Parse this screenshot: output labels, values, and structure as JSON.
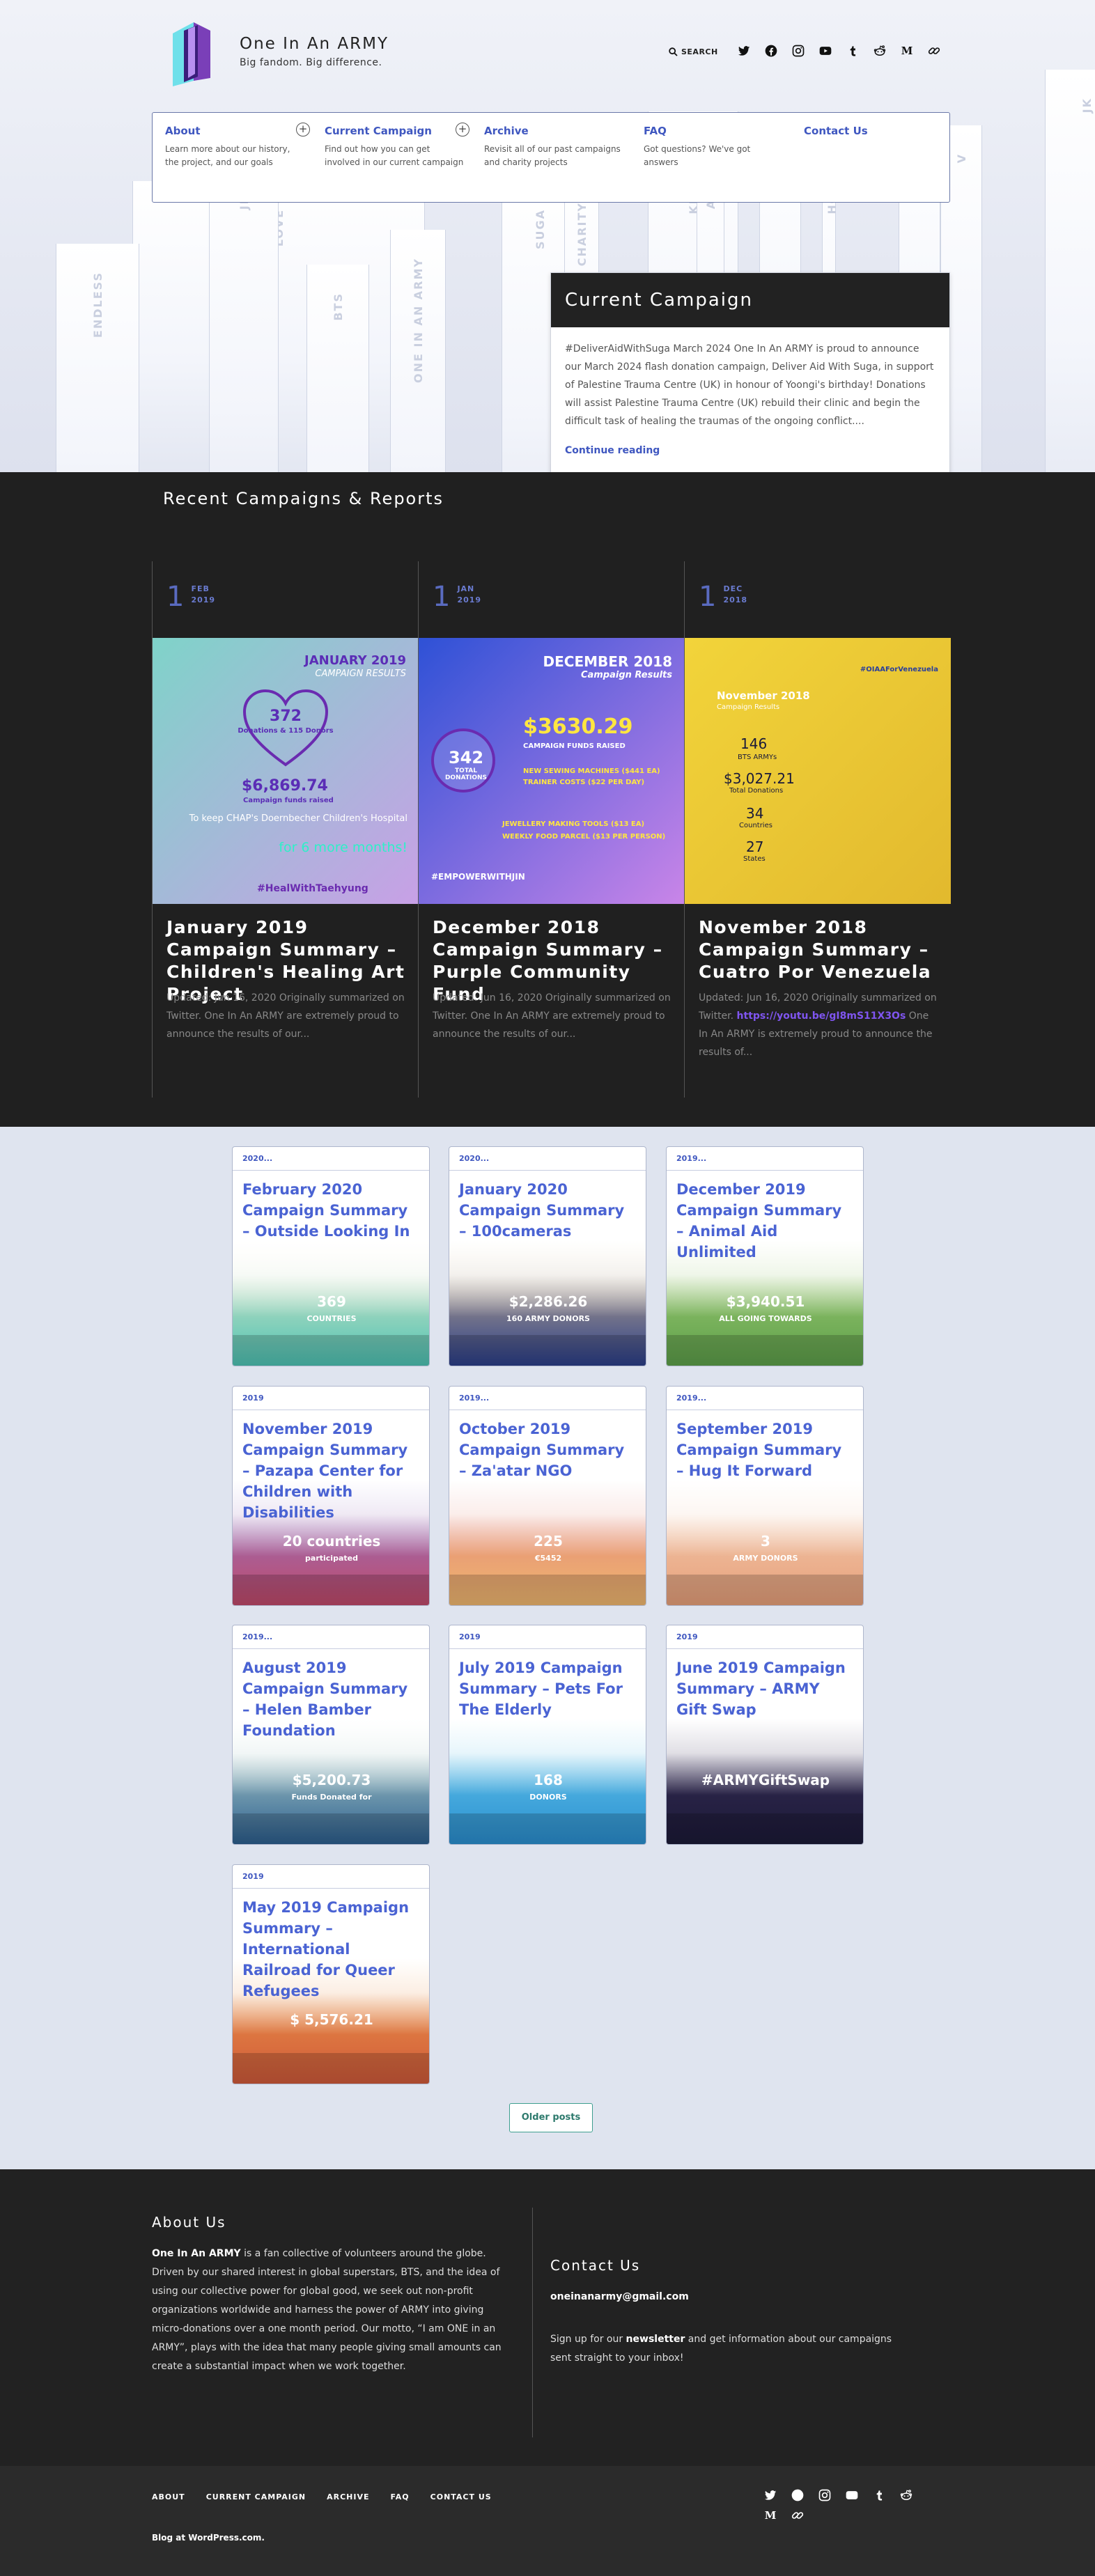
{
  "site": {
    "title": "One In An ARMY",
    "tagline": "Big fandom. Big difference.",
    "search_label": "SEARCH"
  },
  "hero": {
    "pillar_words": [
      "LOVE",
      "JIN",
      "BTS",
      "ONE IN AN ARMY",
      "SUGA",
      "CHARITY",
      "KINDNESS",
      "ARMY",
      "RM",
      "HOPE",
      "JIMIN",
      "V",
      "JK",
      "ENDLESS"
    ]
  },
  "social_icons": [
    "twitter-icon",
    "facebook-icon",
    "instagram-icon",
    "youtube-icon",
    "tumblr-icon",
    "reddit-icon",
    "medium-icon",
    "link-icon"
  ],
  "nav": [
    {
      "title": "About",
      "desc": "Learn more about our history, the project, and our goals",
      "has_sub": true
    },
    {
      "title": "Current Campaign",
      "desc": "Find out how you can get involved in our current campaign",
      "has_sub": true
    },
    {
      "title": "Archive",
      "desc": "Revisit all of our past campaigns and charity projects",
      "has_sub": false
    },
    {
      "title": "FAQ",
      "desc": "Got questions? We've got answers",
      "has_sub": false
    },
    {
      "title": "Contact Us",
      "desc": "",
      "has_sub": false
    }
  ],
  "featured": {
    "heading": "Current Campaign",
    "body": "#DeliverAidWithSuga March 2024 One In An ARMY is proud to announce our March 2024 flash donation campaign, Deliver Aid With Suga, in support of Palestine Trauma Centre (UK) in honour of Yoongi's birthday! Donations will assist Palestine Trauma Centre (UK) rebuild their clinic and begin the difficult task of healing the traumas of the ongoing conflict....",
    "more": "Continue reading"
  },
  "recent": {
    "heading": "Recent Campaigns & Reports",
    "cards": [
      {
        "day": "1",
        "month": "FEB",
        "year": "2019",
        "title": "January 2019 Campaign Summary – Children's Healing Art Project",
        "excerpt": "Updated: Jun 16, 2020 Originally summarized on Twitter. One In An ARMY are extremely proud to announce the results of our...",
        "link": "",
        "excerpt_after": "",
        "img": {
          "bg1": "#7fd3c9",
          "bg2": "#c8a0e6",
          "heading": "JANUARY 2019",
          "sub": "CAMPAIGN RESULTS",
          "big1": "372",
          "big1_label": "Donations & 115 Donors",
          "big2": "$6,869.74",
          "big2_unit": "USD",
          "big2_label": "Campaign funds raised",
          "line1": "To keep CHAP's Doernbecher Children's Hospital",
          "line2": "for 6 more months!",
          "hashtag": "#HealWithTaehyung"
        }
      },
      {
        "day": "1",
        "month": "JAN",
        "year": "2019",
        "title": "December 2018 Campaign Summary – Purple Community Fund",
        "excerpt": "Updated: Jun 16, 2020 Originally summarized on Twitter. One In An ARMY are extremely proud to announce the results of our...",
        "link": "",
        "excerpt_after": "",
        "img": {
          "bg1": "#2e51d6",
          "bg2": "#c985e8",
          "heading": "DECEMBER 2018",
          "sub": "Campaign Results",
          "big1": "$3630.29",
          "big1_unit": "USD",
          "big1_label": "CAMPAIGN FUNDS RAISED",
          "big2": "342",
          "big2_label": "TOTAL DONATIONS",
          "line1": "NEW SEWING MACHINES ($441 EA)",
          "line2": "TRAINER COSTS ($22 PER DAY)",
          "line3": "JEWELLERY MAKING TOOLS ($13 EA)",
          "line4": "WEEKLY FOOD PARCEL ($13 PER PERSON)",
          "hashtag": "#EMPOWERWITHJIN"
        }
      },
      {
        "day": "1",
        "month": "DEC",
        "year": "2018",
        "title": "November 2018 Campaign Summary – Cuatro Por Venezuela",
        "excerpt": "Updated: Jun 16, 2020 Originally summarized on Twitter.",
        "link": "https://youtu.be/gI8mS11X3Os",
        "excerpt_after": " One In An ARMY is extremely proud to announce the results of...",
        "img": {
          "bg1": "#f2d43a",
          "bg2": "#e2b92e",
          "heading": "November 2018",
          "sub": "Campaign Results",
          "big1": "146",
          "big1_label": "BTS ARMYs",
          "big2": "$3,027.21",
          "big2_label": "Total Donations",
          "line1": "34",
          "line2": "Countries",
          "line3": "27",
          "line4": "States",
          "hashtag": "#OIAAForVenezuela"
        }
      }
    ]
  },
  "grid": [
    {
      "tag": "2020...",
      "title": "February 2020 Campaign Summary – Outside Looking In",
      "bg1": "#f3e9c8",
      "bg2": "#4dc3b4",
      "stat": "369",
      "stat2": "COUNTRIES"
    },
    {
      "tag": "2020...",
      "title": "January 2020 Campaign Summary – 100cameras",
      "bg1": "#e0c28a",
      "bg2": "#2c3f8a",
      "stat": "$2,286.26",
      "stat2": "160 ARMY DONORS"
    },
    {
      "tag": "2019...",
      "title": "December 2019 Campaign Summary – Animal Aid Unlimited",
      "bg1": "#a9d07a",
      "bg2": "#5da04a",
      "stat": "$3,940.51",
      "stat2": "ALL GOING TOWARDS"
    },
    {
      "tag": "2019",
      "title": "November 2019 Campaign Summary – Pazapa Center for Children with Disabilities",
      "bg1": "#8b7ad0",
      "bg2": "#c04a6a",
      "stat": "20 countries",
      "stat2": "participated"
    },
    {
      "tag": "2019...",
      "title": "October 2019 Campaign Summary – Za'atar NGO",
      "bg1": "#e07a7a",
      "bg2": "#f0b870",
      "stat": "225",
      "stat2": "€5452"
    },
    {
      "tag": "2019...",
      "title": "September 2019 Campaign Summary – Hug It Forward",
      "bg1": "#f5d2b8",
      "bg2": "#e7a07a",
      "stat": "3",
      "stat2": "ARMY DONORS"
    },
    {
      "tag": "2019...",
      "title": "August 2019 Campaign Summary – Helen Bamber Foundation",
      "bg1": "#cfe9d8",
      "bg2": "#2c5f8f",
      "stat": "$5,200.73",
      "stat2": "Funds Donated for"
    },
    {
      "tag": "2019",
      "title": "July 2019 Campaign Summary – Pets For The Elderly",
      "bg1": "#6fd0f0",
      "bg2": "#2a8fd0",
      "stat": "168",
      "stat2": "DONORS"
    },
    {
      "tag": "2019",
      "title": "June 2019 Campaign Summary – ARMY Gift Swap",
      "bg1": "#3a2f5a",
      "bg2": "#1c1a38",
      "stat": "#ARMYGiftSwap",
      "stat2": ""
    },
    {
      "tag": "2019",
      "title": "May 2019 Campaign Summary – International Railroad for Queer Refugees",
      "bg1": "#f0a04a",
      "bg2": "#d05a3a",
      "stat": "$ 5,576.21",
      "stat2": ""
    }
  ],
  "older_posts": "Older posts",
  "footer": {
    "about_title": "About Us",
    "about_strong": "One In An ARMY",
    "about_text": " is a fan collective of volunteers around the globe. Driven by our shared interest in global superstars, BTS, and the idea of using our collective power for global good, we seek out non-profit organizations worldwide and harness the power of ARMY into giving micro-donations over a one month period. Our motto, “I am ONE in an ARMY”, plays with the idea that many people giving small amounts can create a substantial impact when we work together.",
    "contact_title": "Contact Us",
    "email": "oneinanarmy@gmail.com",
    "newsletter_pre": "Sign up for our ",
    "newsletter_strong": "newsletter",
    "newsletter_post": " and get information about our campaigns sent straight to your inbox!",
    "nav": [
      "ABOUT",
      "CURRENT CAMPAIGN",
      "ARCHIVE",
      "FAQ",
      "CONTACT US"
    ],
    "credit": "Blog at WordPress.com."
  },
  "colors": {
    "accent": "#3f57c0",
    "dark": "#202020",
    "grid_bg": "#dfe4ef",
    "link_purple": "#7f55f0"
  }
}
